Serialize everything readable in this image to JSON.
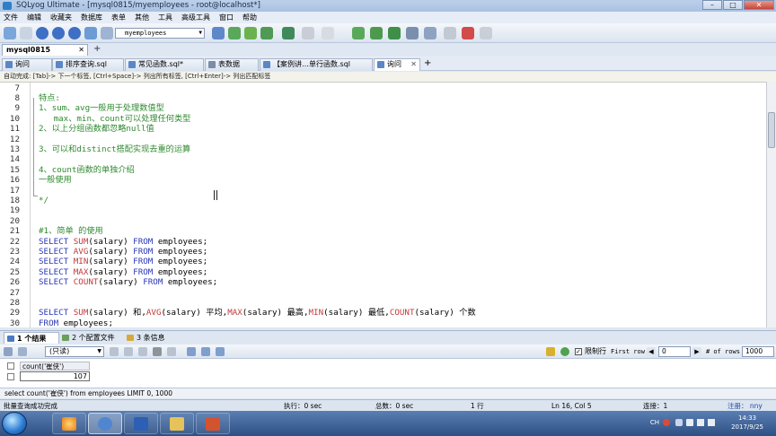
{
  "window": {
    "title": "SQLyog Ultimate - [mysql0815/myemployees - root@localhost*]"
  },
  "menu": [
    "文件",
    "编辑",
    "收藏夹",
    "数据库",
    "表单",
    "其他",
    "工具",
    "高级工具",
    "窗口",
    "帮助"
  ],
  "toolbar": {
    "database": "myemployees"
  },
  "connection_tab": {
    "label": "mysql0815",
    "add": "+"
  },
  "query_tabs": [
    {
      "label": "询问"
    },
    {
      "label": "排序查询.sql"
    },
    {
      "label": "常见函数.sql*"
    },
    {
      "label": "表数据"
    },
    {
      "label": "【案例讲…单行函数.sql"
    },
    {
      "label": "询问"
    }
  ],
  "query_tab_add": "+",
  "hint": "自动完成: [Tab]-> 下一个标签, [Ctrl+Space]-> 列出所有标签, [Ctrl+Enter]-> 列出匹配标签",
  "editor_lines": [
    {
      "n": "7",
      "text": ""
    },
    {
      "n": "8",
      "text": "特点:"
    },
    {
      "n": "9",
      "text": "1、sum、avg一般用于处理数值型"
    },
    {
      "n": "10",
      "text": "   max、min、count可以处理任何类型"
    },
    {
      "n": "11",
      "text": "2、以上分组函数都忽略null值"
    },
    {
      "n": "12",
      "text": ""
    },
    {
      "n": "13",
      "text": "3、可以和distinct搭配实现去重的运算"
    },
    {
      "n": "14",
      "text": ""
    },
    {
      "n": "15",
      "text": "4、count函数的单独介绍"
    },
    {
      "n": "16",
      "text": "一般使用"
    },
    {
      "n": "17",
      "text": ""
    },
    {
      "n": "18",
      "text": "*/"
    },
    {
      "n": "19",
      "text": ""
    },
    {
      "n": "20",
      "text": ""
    },
    {
      "n": "21",
      "text": "#1、简单 的使用"
    },
    {
      "n": "22",
      "text": "SELECT SUM(salary) FROM employees;"
    },
    {
      "n": "23",
      "text": "SELECT AVG(salary) FROM employees;"
    },
    {
      "n": "24",
      "text": "SELECT MIN(salary) FROM employees;"
    },
    {
      "n": "25",
      "text": "SELECT MAX(salary) FROM employees;"
    },
    {
      "n": "26",
      "text": "SELECT COUNT(salary) FROM employees;"
    },
    {
      "n": "27",
      "text": ""
    },
    {
      "n": "28",
      "text": ""
    },
    {
      "n": "29",
      "text": "SELECT SUM(salary) 和,AVG(salary) 平均,MAX(salary) 最高,MIN(salary) 最低,COUNT(salary) 个数"
    },
    {
      "n": "30",
      "text": "FROM employees;"
    }
  ],
  "result_tabs": [
    {
      "label": "1 个结果"
    },
    {
      "label": "2 个配置文件"
    },
    {
      "label": "3 条信息"
    }
  ],
  "result_toolbar": {
    "mode": "(只读)",
    "limit_label": "限制行",
    "first_row_label": "First row",
    "first_row_value": "0",
    "rows_label": "# of rows",
    "rows_value": "1000"
  },
  "result_grid": {
    "column": "count('崔侠')",
    "value": "107"
  },
  "sql_bar": "select count('崔侠') from employees LIMIT 0, 1000",
  "status": {
    "message": "批量查询成功完成",
    "exec": "执行：0 sec",
    "total": "总数：0 sec",
    "rows": "1 行",
    "position": "Ln 16, Col 5",
    "connections": "连接：1",
    "register": "注册：  nny"
  },
  "taskbar": {
    "lang": "CH",
    "time": "14:33",
    "date": "2017/9/25"
  },
  "colors": {
    "comment": "#2f8a2f",
    "keyword": "#2a38b8",
    "function": "#c03a3a"
  }
}
